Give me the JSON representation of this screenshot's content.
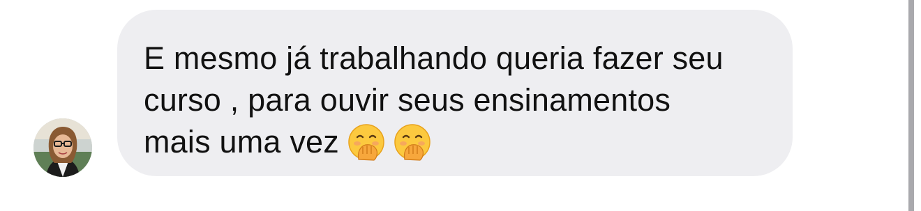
{
  "message": {
    "lines": [
      "E mesmo já trabalhando queria fazer seu",
      "curso , para ouvir seus ensinamentos",
      "mais uma vez"
    ],
    "emojis": [
      "face-with-hand-over-mouth-icon",
      "face-with-hand-over-mouth-icon"
    ]
  },
  "colors": {
    "bubble": "#eeeef1",
    "text": "#111111",
    "background": "#ffffff",
    "scrollbar": "#a9a9ad"
  }
}
